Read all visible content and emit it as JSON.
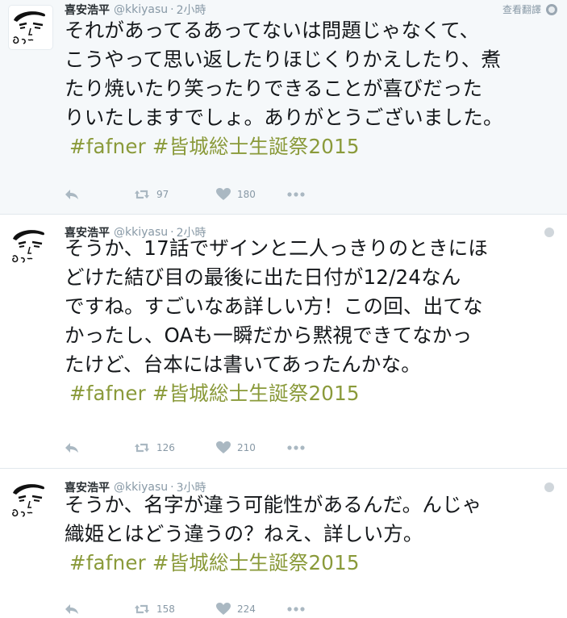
{
  "tweets": [
    {
      "name": "喜安浩平",
      "username": "@kkiyasu",
      "time": "2小時",
      "translate_label": "查看翻譯",
      "lines": [
        "それがあってるあってないは問題じゃなくて、",
        "こうやって思い返したりほじくりかえしたり、煮",
        "たり焼いたり笑ったりできることが喜びだった",
        "りいたしますでしょ。ありがとうございました。"
      ],
      "hashtags": [
        "#fafner",
        "#皆城総士生誕祭2015"
      ],
      "retweets": "97",
      "likes": "180"
    },
    {
      "name": "喜安浩平",
      "username": "@kkiyasu",
      "time": "2小時",
      "lines": [
        "そうか、17話でザインと二人っきりのときにほ",
        "どけた結び目の最後に出た日付が12/24なん",
        "ですね。すごいなあ詳しい方！この回、出てな",
        "かったし、OAも一瞬だから黙視できてなかっ",
        "たけど、台本には書いてあったんかな。"
      ],
      "hashtags": [
        "#fafner",
        "#皆城総士生誕祭2015"
      ],
      "retweets": "126",
      "likes": "210"
    },
    {
      "name": "喜安浩平",
      "username": "@kkiyasu",
      "time": "3小時",
      "lines": [
        "そうか、名字が違う可能性があるんだ。んじゃ",
        "織姫とはどう違うの？ねえ、詳しい方。"
      ],
      "hashtags": [
        "#fafner",
        "#皆城総士生誕祭2015"
      ],
      "retweets": "158",
      "likes": "224"
    }
  ],
  "sep": "·",
  "colors": {
    "hashtag": "#8a9a3a",
    "highlight_bg": "#f5f8fa",
    "meta": "#8899a6",
    "icon": "#aab8c2"
  },
  "icons": [
    "avatar-drawing",
    "reply-icon",
    "retweet-icon",
    "heart-icon",
    "more-icon",
    "globe-icon"
  ]
}
